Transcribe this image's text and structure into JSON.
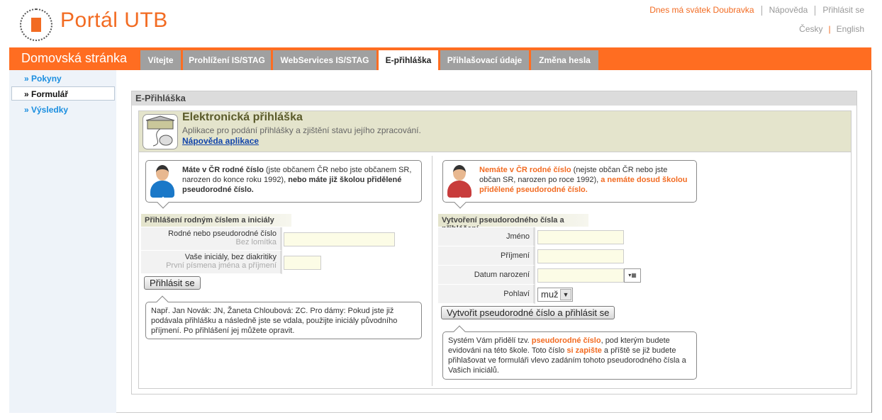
{
  "header": {
    "logo_text": "Portál UTB",
    "nameday": "Dnes má svátek Doubravka",
    "help": "Nápověda",
    "login": "Přihlásit se",
    "lang_cs": "Česky",
    "lang_en": "English"
  },
  "nav": {
    "home": "Domovská stránka",
    "tabs": [
      {
        "label": "Vítejte"
      },
      {
        "label": "Prohlížení IS/STAG"
      },
      {
        "label": "WebServices IS/STAG"
      },
      {
        "label": "E-přihláška",
        "active": true
      },
      {
        "label": "Přihlašovací údaje"
      },
      {
        "label": "Změna hesla"
      }
    ]
  },
  "sidebar": {
    "items": [
      {
        "label": "» Pokyny"
      },
      {
        "label": "» Formulář",
        "active": true
      },
      {
        "label": "» Výsledky"
      }
    ]
  },
  "panel": {
    "title": "E-Přihláška",
    "app_title": "Elektronická přihláška",
    "app_subtitle": "Aplikace pro podání přihlášky a zjištění stavu jejího zpracování.",
    "app_help": "Nápověda aplikace"
  },
  "left": {
    "bubble": {
      "t1": "Máte v ČR rodné číslo",
      "t2": " (jste občanem ČR nebo jste občanem SR, narozen do konce roku 1992), ",
      "t3": "nebo máte již školou přidělené pseudorodné číslo."
    },
    "section": "Přihlášení rodným číslem a iniciály",
    "fields": [
      {
        "label": "Rodné nebo pseudorodné číslo",
        "hint": "Bez lomítka",
        "value": ""
      },
      {
        "label": "Vaše iniciály, bez diakritiky",
        "hint": "První písmena jména a příjmení",
        "value": ""
      }
    ],
    "button": "Přihlásit se",
    "note": "Např. Jan Novák: JN, Žaneta Chloubová: ZC. Pro dámy: Pokud jste již podávala přihlášku a následně jste se vdala, použijte iniciály původního příjmení. Po přihlášení jej můžete opravit."
  },
  "right": {
    "bubble": {
      "t1": "Nemáte v ČR rodné číslo",
      "t2": " (nejste občan ČR nebo jste občan SR, narozen po roce 1992), ",
      "t3": "a nemáte dosud školou přidělené pseudorodné číslo."
    },
    "section": "Vytvoření pseudorodného čísla a přihlášení",
    "fields": [
      {
        "label": "Jméno",
        "value": ""
      },
      {
        "label": "Příjmení",
        "value": ""
      },
      {
        "label": "Datum narození",
        "value": ""
      },
      {
        "label": "Pohlaví",
        "value": "muž"
      }
    ],
    "button": "Vytvořit pseudorodné číslo a přihlásit se",
    "note": {
      "p1": "Systém Vám přidělí tzv. ",
      "p2": "pseudorodné číslo",
      "p3": ", pod kterým budete evidováni na této škole. Toto číslo ",
      "p4": "si zapište",
      "p5": " a příště se již budete přihlašovat ve formuláři vlevo zadáním tohoto pseudorodného čísla a Vašich iniciálů."
    }
  },
  "colors": {
    "accent": "#ff6d21",
    "link": "#1a8ee0"
  }
}
